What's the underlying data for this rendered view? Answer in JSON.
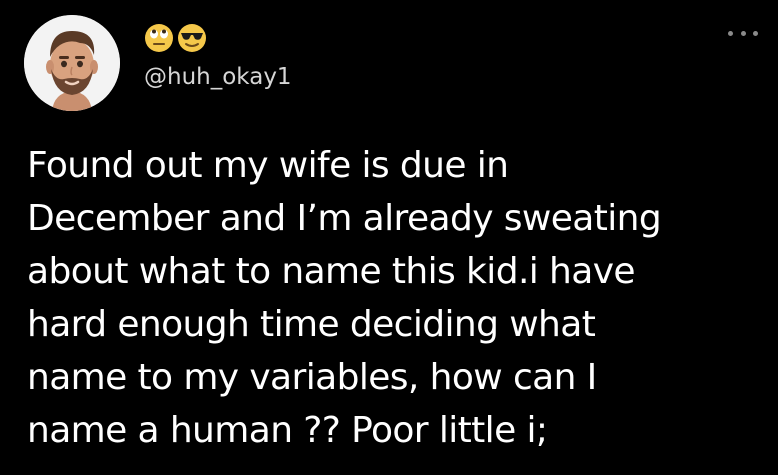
{
  "author": {
    "display_name_emojis": [
      "rolling-eyes-emoji",
      "sunglasses-emoji"
    ],
    "handle": "@huh_okay1",
    "avatar_icon": "memoji-avatar-icon"
  },
  "menu": {
    "icon": "more-options-icon"
  },
  "tweet": {
    "lines": [
      "Found out my wife is due in",
      "December and I’m already sweating",
      "about what to name this kid.i have",
      "hard enough time deciding what",
      "name to my variables, how can I",
      "name a human ?? Poor little i;"
    ]
  },
  "colors": {
    "background": "#000000",
    "text": "#ffffff",
    "handle": "#d6d6d6",
    "menu_dots": "#8a8a8a"
  }
}
